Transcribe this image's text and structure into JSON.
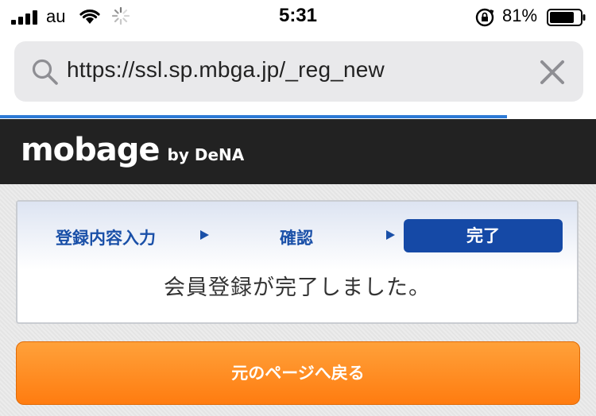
{
  "status_bar": {
    "carrier": "au",
    "time": "5:31",
    "battery_percent": "81%",
    "battery_level": 0.81
  },
  "address_bar": {
    "url": "https://ssl.sp.mbga.jp/_reg_new",
    "load_progress": 0.85
  },
  "header": {
    "logo_text": "mobage",
    "logo_sub": "by DeNA"
  },
  "steps": {
    "items": [
      "登録内容入力",
      "確認",
      "完了"
    ],
    "active_index": 2
  },
  "message": "会員登録が完了しました。",
  "back_button_label": "元のページへ戻る",
  "colors": {
    "accent": "#1549a6",
    "button": "#ff8c1f",
    "header_bg": "#222222",
    "progress": "#2d7ad6"
  }
}
